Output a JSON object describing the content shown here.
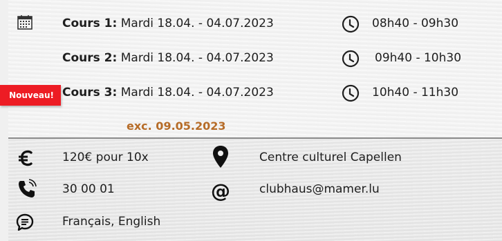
{
  "courses": [
    {
      "label": "Cours 1",
      "sep": ":",
      "dates": " Mardi 18.04. - 04.07.2023",
      "time": "08h40 - 09h30"
    },
    {
      "label": "Cours 2",
      "sep": ":",
      "dates": " Mardi 18.04. - 04.07.2023",
      "time": "09h40 - 10h30"
    },
    {
      "label": "Cours 3",
      "sep": ":",
      "dates": " Mardi 18.04. - 04.07.2023",
      "time": "10h40 - 11h30"
    }
  ],
  "badge": "Nouveau!",
  "exception": "exc. 09.05.2023",
  "info": {
    "price": "120€ pour 10x",
    "location": "Centre culturel Capellen",
    "phone": "30 00 01",
    "email": "clubhaus@mamer.lu",
    "languages": "Français, English"
  },
  "colors": {
    "badge": "#ed1c24",
    "exception": "#b66c28",
    "divider": "#8a8a8a"
  },
  "icons": [
    "calendar-icon",
    "clock-icon",
    "euro-icon",
    "map-pin-icon",
    "phone-icon",
    "at-icon",
    "chat-icon"
  ]
}
